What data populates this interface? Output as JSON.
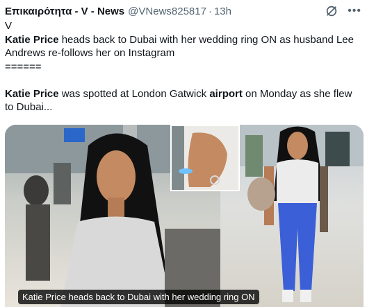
{
  "tweet": {
    "author_name": "Επικαιρότητα - V - News",
    "handle": "@VNews825817",
    "separator": "·",
    "time": "13h",
    "icons": {
      "grok": "grok-slash-icon",
      "more": "more-dots-icon"
    },
    "line1": "V",
    "line2_bold": "Katie Price",
    "line2_rest": " heads back to Dubai with her wedding ring ON as husband Lee Andrews re-follows her on Instagram",
    "line3": "======",
    "para2_bold1": "Katie Price",
    "para2_mid": " was spotted at London Gatwick ",
    "para2_bold2": "airport",
    "para2_end": " on Monday as she flew to Dubai..."
  },
  "media": {
    "caption": "Katie Price heads back to Dubai with her wedding ring ON"
  }
}
